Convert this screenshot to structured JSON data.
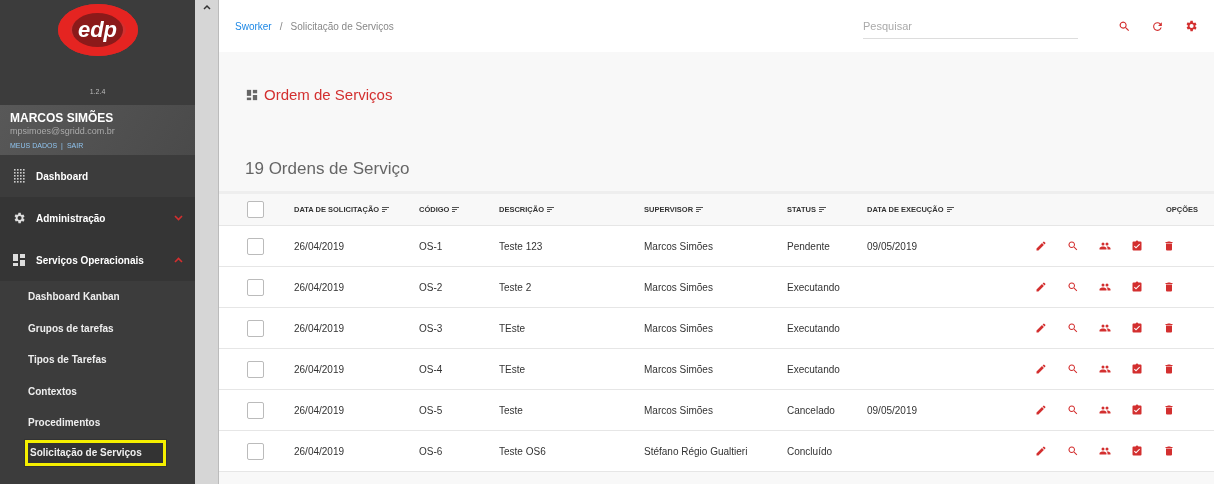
{
  "app": {
    "logo": "edp",
    "version": "1.2.4"
  },
  "user": {
    "name": "MARCOS SIMÕES",
    "email": "mpsimoes@sgridd.com.br",
    "links": [
      "MEUS DADOS",
      "SAIR"
    ],
    "link_separator": "|"
  },
  "sidebar": {
    "items": [
      {
        "label": "Dashboard",
        "kind": "link"
      },
      {
        "label": "Administração",
        "kind": "group",
        "expanded": false
      },
      {
        "label": "Serviços Operacionais",
        "kind": "group",
        "expanded": true,
        "children": [
          {
            "label": "Dashboard Kanban",
            "selected": false
          },
          {
            "label": "Grupos de tarefas",
            "selected": false
          },
          {
            "label": "Tipos de Tarefas",
            "selected": false
          },
          {
            "label": "Contextos",
            "selected": false
          },
          {
            "label": "Procedimentos",
            "selected": false
          },
          {
            "label": "Solicitação de Serviços",
            "selected": true
          }
        ]
      }
    ]
  },
  "breadcrumb": [
    "Sworker",
    "Solicitação de Serviços"
  ],
  "breadcrumb_separator": "/",
  "search": {
    "placeholder": "Pesquisar"
  },
  "page_title": "Ordem de Serviços",
  "count_title": "19 Ordens de Serviço",
  "table": {
    "all_checked": false,
    "columns": [
      {
        "label": "DATA DE SOLICITAÇÃO",
        "sortable": true
      },
      {
        "label": "CÓDIGO",
        "sortable": true
      },
      {
        "label": "DESCRIÇÃO",
        "sortable": true
      },
      {
        "label": "SUPERVISOR",
        "sortable": true
      },
      {
        "label": "STATUS",
        "sortable": true
      },
      {
        "label": "DATA DE EXECUÇÃO",
        "sortable": true
      },
      {
        "label": "OPÇÕES",
        "sortable": false
      }
    ],
    "rows": [
      {
        "checked": false,
        "date": "26/04/2019",
        "code": "OS-1",
        "description": "Teste 123",
        "supervisor": "Marcos Simões",
        "status": "Pendente",
        "execution_date": "09/05/2019"
      },
      {
        "checked": false,
        "date": "26/04/2019",
        "code": "OS-2",
        "description": "Teste 2",
        "supervisor": "Marcos Simões",
        "status": "Executando"
      },
      {
        "checked": false,
        "date": "26/04/2019",
        "code": "OS-3",
        "description": "TEste",
        "supervisor": "Marcos Simões",
        "status": "Executando"
      },
      {
        "checked": false,
        "date": "26/04/2019",
        "code": "OS-4",
        "description": "TEste",
        "supervisor": "Marcos Simões",
        "status": "Executando"
      },
      {
        "checked": false,
        "date": "26/04/2019",
        "code": "OS-5",
        "description": "Teste",
        "supervisor": "Marcos Simões",
        "status": "Cancelado",
        "execution_date": "09/05/2019"
      },
      {
        "checked": false,
        "date": "26/04/2019",
        "code": "OS-6",
        "description": "Teste OS6",
        "supervisor": "Stéfano Régio Gualtieri",
        "status": "Concluído"
      }
    ]
  }
}
